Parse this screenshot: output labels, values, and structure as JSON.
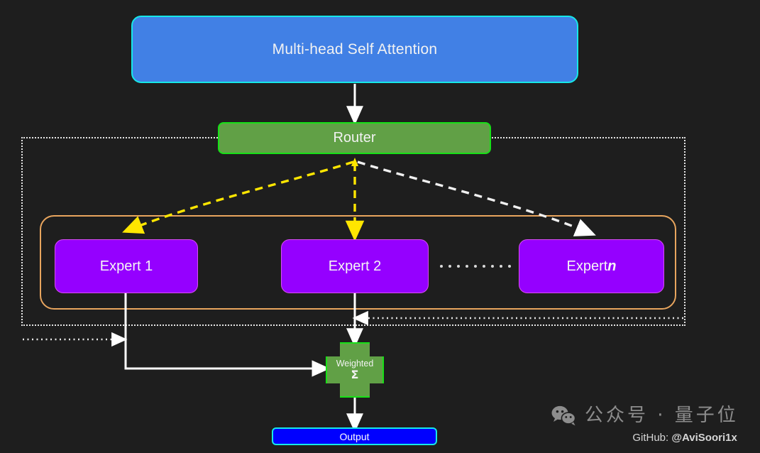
{
  "diagram": {
    "title_block": {
      "label": "Multi-head Self Attention"
    },
    "router": {
      "label": "Router"
    },
    "experts": [
      {
        "label": "Expert 1"
      },
      {
        "label": "Expert 2"
      },
      {
        "label_prefix": "Expert ",
        "label_italic": "n"
      }
    ],
    "ellipsis_dot_count": 9,
    "weighted_sum": {
      "label": "Weighted",
      "symbol": "Σ"
    },
    "output": {
      "label": "Output"
    },
    "colors": {
      "background": "#1e1e1e",
      "attention_fill": "#4180e5",
      "attention_border": "#16e8e8",
      "router_fill": "#61a046",
      "router_border": "#17e017",
      "expert_fill": "#9500ff",
      "expert_border": "#d94df7",
      "experts_container_border": "#e8a55e",
      "moe_boundary_border": "#e6e6e6",
      "weighted_fill": "#61a046",
      "weighted_border": "#17e017",
      "output_fill": "#0000ff",
      "output_border": "#16e8e8",
      "routing_active_edge": "#ffe600",
      "routing_inactive_edge": "#f0f0f0",
      "solid_edge": "#ffffff"
    }
  },
  "watermark": {
    "icon": "wechat-icon",
    "chinese_text": "公众号 · 量子位",
    "github_prefix": "GitHub: ",
    "github_handle": "@AviSoori1x"
  }
}
